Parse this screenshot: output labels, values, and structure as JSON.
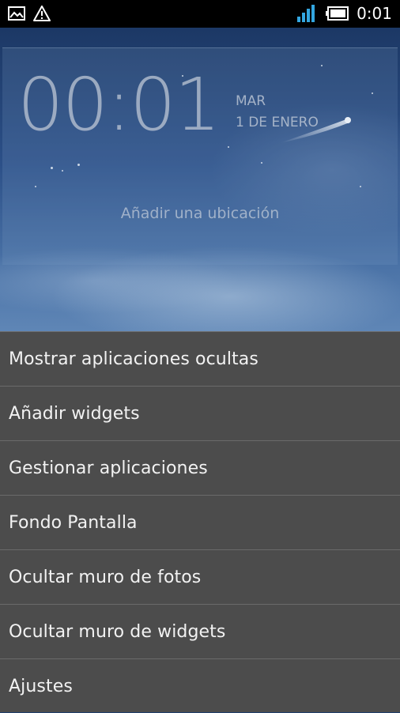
{
  "status_bar": {
    "time": "0:01",
    "icons_left": [
      "image-icon",
      "warning-icon"
    ],
    "icons_right": [
      "signal-icon",
      "battery-icon"
    ],
    "signal_color": "#33a6e0"
  },
  "lockscreen": {
    "clock": "00:01",
    "day": "MAR",
    "date": "1 DE ENERO",
    "location_prompt": "Añadir una ubicación"
  },
  "menu": {
    "items": [
      {
        "label": "Mostrar aplicaciones ocultas"
      },
      {
        "label": "Añadir widgets"
      },
      {
        "label": "Gestionar aplicaciones"
      },
      {
        "label": "Fondo Pantalla"
      },
      {
        "label": "Ocultar muro de fotos"
      },
      {
        "label": "Ocultar muro de widgets"
      },
      {
        "label": "Ajustes"
      }
    ]
  },
  "colors": {
    "menu_background": "#4c4c4c",
    "menu_divider": "#6a6a6a",
    "menu_text": "#f2f2f2",
    "status_bar": "#000000"
  }
}
